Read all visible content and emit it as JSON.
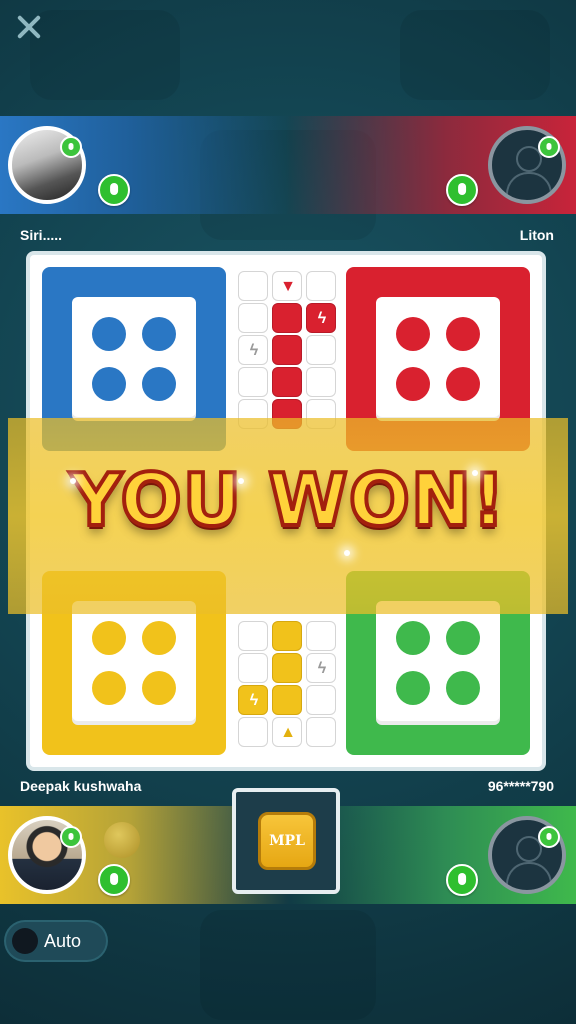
{
  "banner": {
    "text": "YOU WON!"
  },
  "players": {
    "top_left": {
      "name": "Siri....."
    },
    "top_right": {
      "name": "Liton"
    },
    "bottom_left": {
      "name": "Deepak kushwaha"
    },
    "bottom_right": {
      "name": "96*****790"
    }
  },
  "dice": {
    "label": "MPL"
  },
  "auto_toggle": {
    "label": "Auto"
  },
  "colors": {
    "blue": "#2a77c4",
    "red": "#d9212f",
    "yellow": "#f1c21b",
    "green": "#3fb94c"
  }
}
